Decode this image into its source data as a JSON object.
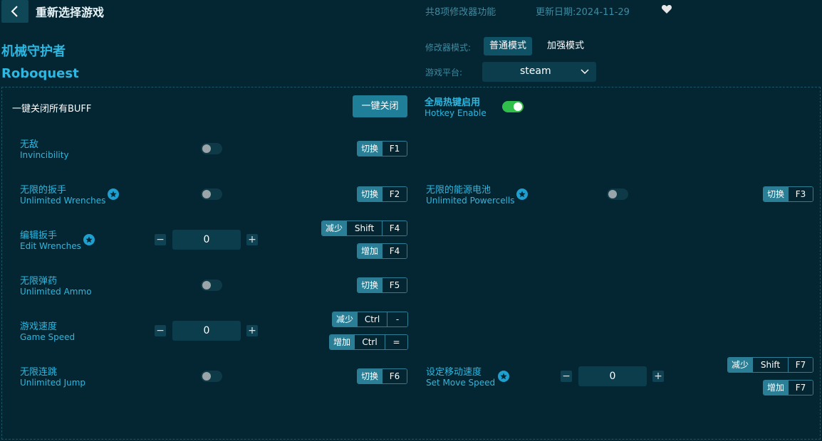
{
  "header": {
    "title": "重新选择游戏",
    "feature_count": "共8项修改器功能",
    "update_date": "更新日期:2024-11-29"
  },
  "game": {
    "name_cn": "机械守护者",
    "name_en": "Roboquest"
  },
  "mode": {
    "label": "修改器模式:",
    "options": [
      "普通模式",
      "加强模式"
    ],
    "selected": "普通模式"
  },
  "platform": {
    "label": "游戏平台:",
    "value": "steam"
  },
  "buff": {
    "label": "一键关闭所有BUFF",
    "button": "一键关闭"
  },
  "hotkey": {
    "label_cn": "全局热键启用",
    "label_en": "Hotkey Enable",
    "enabled": true
  },
  "features": [
    {
      "cn": "无敌",
      "en": "Invincibility",
      "type": "toggle",
      "on": false,
      "tag": "切换",
      "keys": [
        "F1"
      ]
    },
    {
      "cn": "无限的扳手",
      "en": "Unlimited Wrenches",
      "type": "toggle",
      "on": false,
      "tag": "切换",
      "keys": [
        "F2"
      ]
    },
    {
      "cn": "无限的能源电池",
      "en": "Unlimited Powercells",
      "type": "toggle",
      "on": false,
      "tag": "切换",
      "keys": [
        "F3"
      ]
    },
    {
      "cn": "编辑扳手",
      "en": "Edit Wrenches",
      "type": "stepper",
      "value": "0",
      "dec_tag": "减少",
      "dec_keys": [
        "Shift",
        "F4"
      ],
      "inc_tag": "增加",
      "inc_keys": [
        "F4"
      ]
    },
    {
      "cn": "无限弹药",
      "en": "Unlimited Ammo",
      "type": "toggle",
      "on": false,
      "tag": "切换",
      "keys": [
        "F5"
      ]
    },
    {
      "cn": "游戏速度",
      "en": "Game Speed",
      "type": "stepper",
      "value": "0",
      "dec_tag": "减少",
      "dec_keys": [
        "Ctrl",
        "-"
      ],
      "inc_tag": "增加",
      "inc_keys": [
        "Ctrl",
        "="
      ]
    },
    {
      "cn": "无限连跳",
      "en": "Unlimited Jump",
      "type": "toggle",
      "on": false,
      "tag": "切换",
      "keys": [
        "F6"
      ]
    },
    {
      "cn": "设定移动速度",
      "en": "Set Move Speed",
      "type": "stepper",
      "value": "0",
      "dec_tag": "减少",
      "dec_keys": [
        "Shift",
        "F7"
      ],
      "inc_tag": "增加",
      "inc_keys": [
        "F7"
      ]
    }
  ],
  "stepper_symbols": {
    "minus": "−",
    "plus": "+"
  },
  "icons": {
    "back": "chevron-left-icon",
    "favorite": "heart-icon",
    "star": "star-icon",
    "dropdown": "chevron-down-icon"
  },
  "colors": {
    "background": "#032632",
    "accent": "#2eb7e0",
    "toggle_on": "#2fbf4a"
  }
}
